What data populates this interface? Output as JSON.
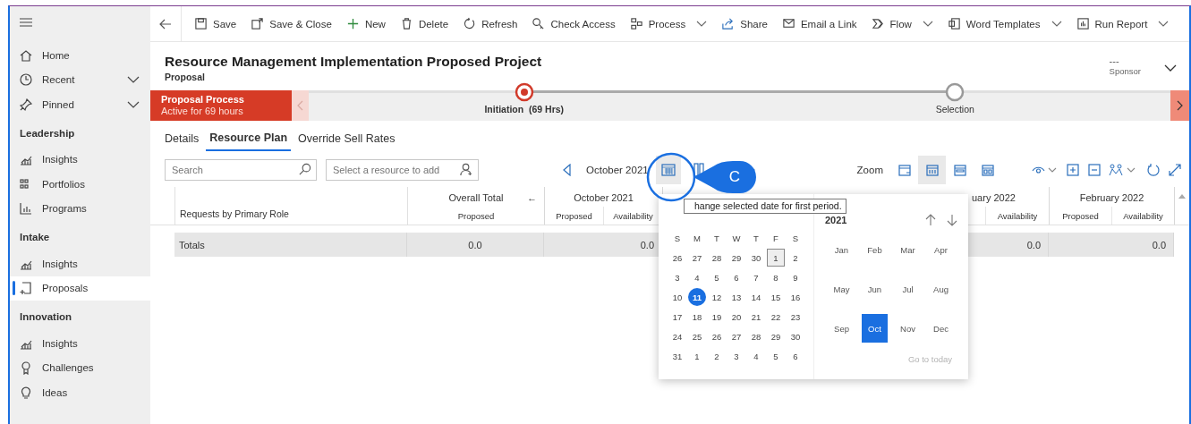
{
  "sidebar": {
    "top_items": [
      {
        "label": "Home",
        "expandable": false
      },
      {
        "label": "Recent",
        "expandable": true
      },
      {
        "label": "Pinned",
        "expandable": true
      }
    ],
    "groups": [
      {
        "title": "Leadership",
        "items": [
          {
            "label": "Insights",
            "selected": false
          },
          {
            "label": "Portfolios",
            "selected": false
          },
          {
            "label": "Programs",
            "selected": false
          }
        ]
      },
      {
        "title": "Intake",
        "items": [
          {
            "label": "Insights",
            "selected": false
          },
          {
            "label": "Proposals",
            "selected": true
          }
        ]
      },
      {
        "title": "Innovation",
        "items": [
          {
            "label": "Insights",
            "selected": false
          },
          {
            "label": "Challenges",
            "selected": false
          },
          {
            "label": "Ideas",
            "selected": false
          }
        ]
      }
    ]
  },
  "toolbar": {
    "items": [
      {
        "label": "Save",
        "has_menu": false
      },
      {
        "label": "Save & Close",
        "has_menu": false
      },
      {
        "label": "New",
        "has_menu": false
      },
      {
        "label": "Delete",
        "has_menu": false
      },
      {
        "label": "Refresh",
        "has_menu": false
      },
      {
        "label": "Check Access",
        "has_menu": false
      },
      {
        "label": "Process",
        "has_menu": true
      },
      {
        "label": "Share",
        "has_menu": false
      },
      {
        "label": "Email a Link",
        "has_menu": false
      },
      {
        "label": "Flow",
        "has_menu": true
      },
      {
        "label": "Word Templates",
        "has_menu": true
      },
      {
        "label": "Run Report",
        "has_menu": true
      }
    ]
  },
  "header": {
    "title": "Resource Management Implementation Proposed Project",
    "subtitle": "Proposal",
    "owner_value": "---",
    "owner_label": "Sponsor"
  },
  "process": {
    "name": "Proposal Process",
    "status": "Active for 69 hours",
    "stages": [
      {
        "label": "Initiation",
        "duration": "(69 Hrs)",
        "active": true
      },
      {
        "label": "Selection",
        "active": false
      }
    ]
  },
  "tabs": [
    {
      "label": "Details",
      "selected": false
    },
    {
      "label": "Resource Plan",
      "selected": true
    },
    {
      "label": "Override Sell Rates",
      "selected": false
    }
  ],
  "search": {
    "placeholder": "Search"
  },
  "resource_picker": {
    "placeholder": "Select a resource to add"
  },
  "period": "October 2021",
  "zoom": {
    "label": "Zoom",
    "views": [
      {
        "selected": false
      },
      {
        "selected": true
      },
      {
        "selected": false
      },
      {
        "selected": false
      }
    ]
  },
  "table": {
    "first_column": "Requests by Primary Role",
    "totals_label": "Totals",
    "groups": [
      {
        "title": "Overall Total",
        "collapse_glyph": "←",
        "subs": [
          {
            "label": "Proposed",
            "total": "0.0"
          }
        ]
      },
      {
        "title": "October 2021",
        "subs": [
          {
            "label": "Proposed"
          },
          {
            "label": "Availability",
            "total": "0.0"
          }
        ]
      },
      {
        "title": "uary 2022",
        "cut_off": true,
        "subs": [
          {
            "label": "Availability",
            "total": "0.0"
          }
        ]
      },
      {
        "title": "February 2022",
        "subs": [
          {
            "label": "Proposed"
          },
          {
            "label": "Availability",
            "total": "0.0"
          }
        ]
      }
    ]
  },
  "date_picker": {
    "weekdays": [
      "S",
      "M",
      "T",
      "W",
      "T",
      "F",
      "S"
    ],
    "days": [
      {
        "day": "26",
        "selected": false,
        "outlined": false
      },
      {
        "day": "27",
        "selected": false,
        "outlined": false
      },
      {
        "day": "28",
        "selected": false,
        "outlined": false
      },
      {
        "day": "29",
        "selected": false,
        "outlined": false
      },
      {
        "day": "30",
        "selected": false,
        "outlined": false
      },
      {
        "day": "1",
        "selected": false,
        "outlined": true
      },
      {
        "day": "2",
        "selected": false,
        "outlined": false
      },
      {
        "day": "3",
        "selected": false,
        "outlined": false
      },
      {
        "day": "4",
        "selected": false,
        "outlined": false
      },
      {
        "day": "5",
        "selected": false,
        "outlined": false
      },
      {
        "day": "6",
        "selected": false,
        "outlined": false
      },
      {
        "day": "7",
        "selected": false,
        "outlined": false
      },
      {
        "day": "8",
        "selected": false,
        "outlined": false
      },
      {
        "day": "9",
        "selected": false,
        "outlined": false
      },
      {
        "day": "10",
        "selected": false,
        "outlined": false
      },
      {
        "day": "11",
        "selected": true,
        "outlined": false
      },
      {
        "day": "12",
        "selected": false,
        "outlined": false
      },
      {
        "day": "13",
        "selected": false,
        "outlined": false
      },
      {
        "day": "14",
        "selected": false,
        "outlined": false
      },
      {
        "day": "15",
        "selected": false,
        "outlined": false
      },
      {
        "day": "16",
        "selected": false,
        "outlined": false
      },
      {
        "day": "17",
        "selected": false,
        "outlined": false
      },
      {
        "day": "18",
        "selected": false,
        "outlined": false
      },
      {
        "day": "19",
        "selected": false,
        "outlined": false
      },
      {
        "day": "20",
        "selected": false,
        "outlined": false
      },
      {
        "day": "21",
        "selected": false,
        "outlined": false
      },
      {
        "day": "22",
        "selected": false,
        "outlined": false
      },
      {
        "day": "23",
        "selected": false,
        "outlined": false
      },
      {
        "day": "24",
        "selected": false,
        "outlined": false
      },
      {
        "day": "25",
        "selected": false,
        "outlined": false
      },
      {
        "day": "26",
        "selected": false,
        "outlined": false
      },
      {
        "day": "27",
        "selected": false,
        "outlined": false
      },
      {
        "day": "28",
        "selected": false,
        "outlined": false
      },
      {
        "day": "29",
        "selected": false,
        "outlined": false
      },
      {
        "day": "30",
        "selected": false,
        "outlined": false
      },
      {
        "day": "31",
        "selected": false,
        "outlined": false
      },
      {
        "day": "1",
        "selected": false,
        "outlined": false
      },
      {
        "day": "2",
        "selected": false,
        "outlined": false
      },
      {
        "day": "3",
        "selected": false,
        "outlined": false
      },
      {
        "day": "4",
        "selected": false,
        "outlined": false
      },
      {
        "day": "5",
        "selected": false,
        "outlined": false
      },
      {
        "day": "6",
        "selected": false,
        "outlined": false
      }
    ],
    "year": "2021",
    "months": [
      {
        "label": "Jan",
        "selected": false
      },
      {
        "label": "Feb",
        "selected": false
      },
      {
        "label": "Mar",
        "selected": false
      },
      {
        "label": "Apr",
        "selected": false
      },
      {
        "label": "May",
        "selected": false
      },
      {
        "label": "Jun",
        "selected": false
      },
      {
        "label": "Jul",
        "selected": false
      },
      {
        "label": "Aug",
        "selected": false
      },
      {
        "label": "Sep",
        "selected": false
      },
      {
        "label": "Oct",
        "selected": true
      },
      {
        "label": "Nov",
        "selected": false
      },
      {
        "label": "Dec",
        "selected": false
      }
    ],
    "go_to_today": {
      "label": "Go to today",
      "disabled": true
    }
  },
  "tooltip": "hange selected date for first period.",
  "callout": {
    "label": "C"
  }
}
